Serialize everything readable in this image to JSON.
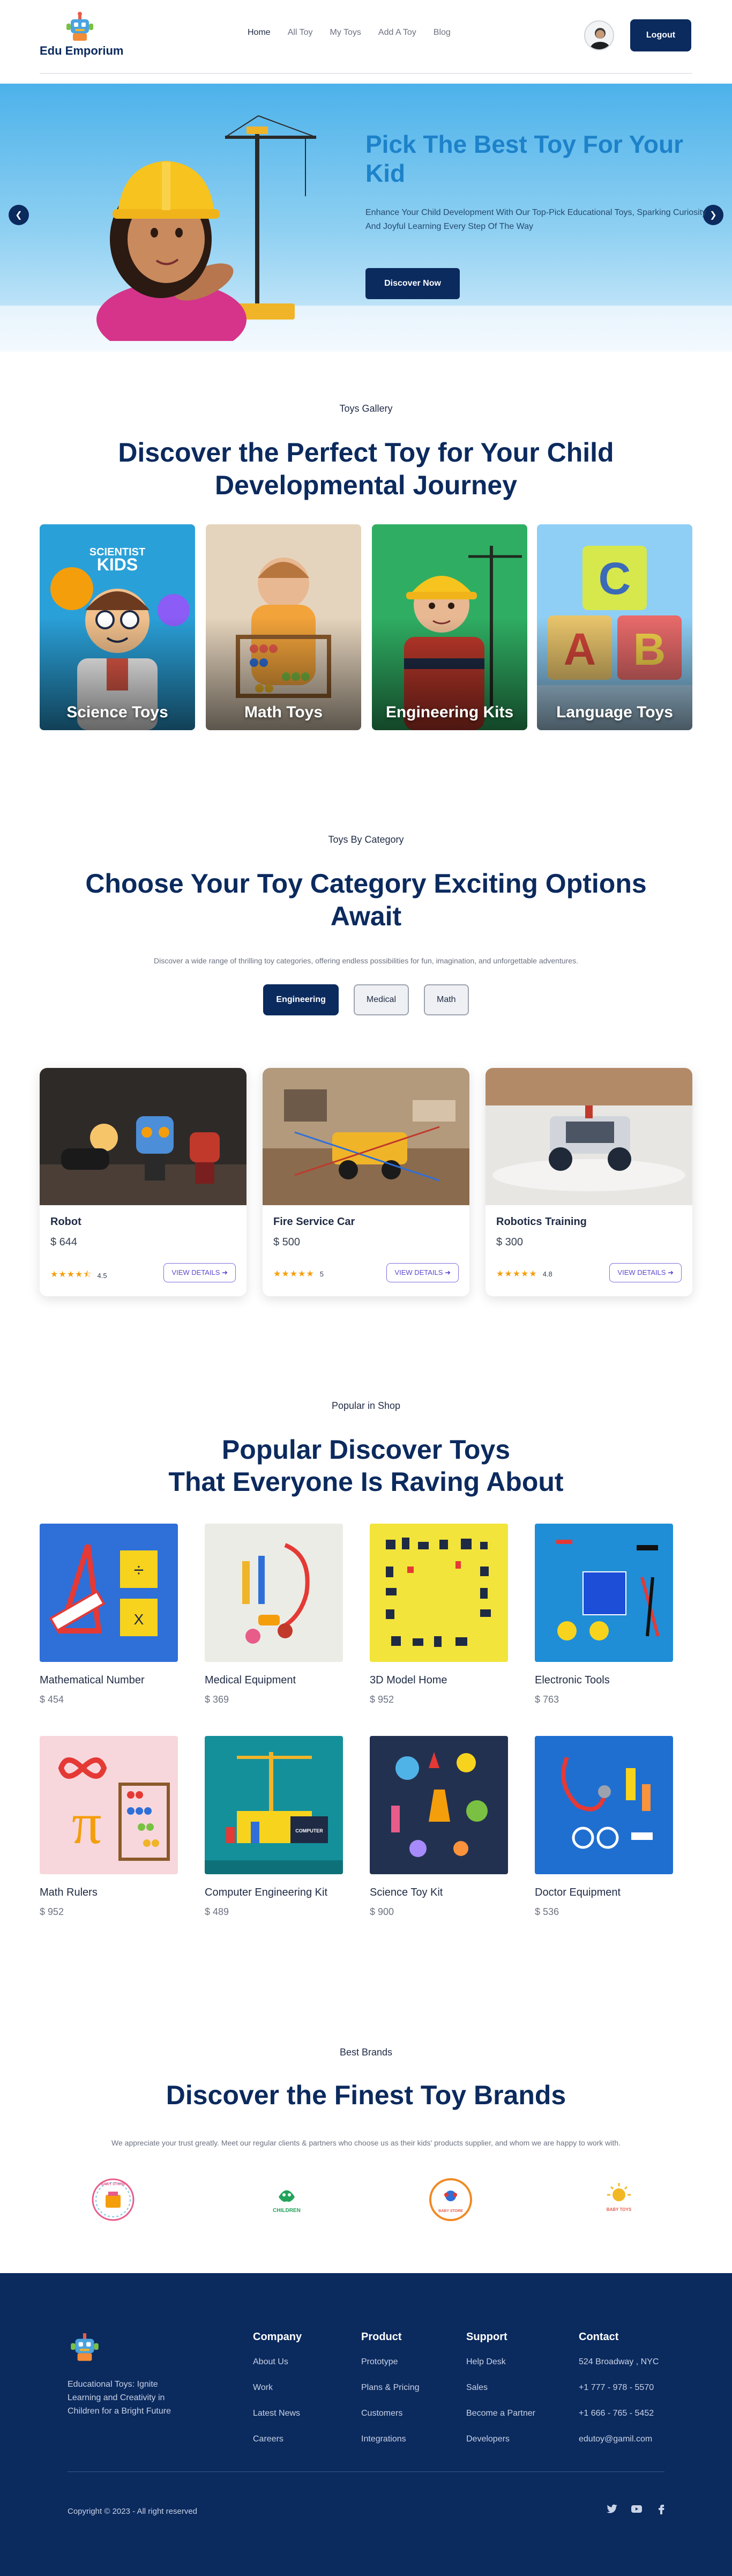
{
  "brand": {
    "name": "Edu Emporium"
  },
  "nav": {
    "links": [
      {
        "label": "Home",
        "active": true
      },
      {
        "label": "All Toy",
        "active": false
      },
      {
        "label": "My Toys",
        "active": false
      },
      {
        "label": "Add A Toy",
        "active": false
      },
      {
        "label": "Blog",
        "active": false
      }
    ],
    "logout": "Logout"
  },
  "hero": {
    "title": "Pick The Best Toy For Your Kid",
    "description": "Enhance Your Child Development With Our Top-Pick Educational Toys, Sparking Curiosity And Joyful Learning Every Step Of The Way",
    "cta": "Discover Now",
    "prev_icon": "arrow-left-icon",
    "next_icon": "arrow-right-icon"
  },
  "gallery": {
    "tag": "Toys Gallery",
    "title": "Discover the Perfect Toy for Your Child Developmental Journey",
    "cards": [
      {
        "label": "Science Toys",
        "badge": "SCIENTIST KIDS"
      },
      {
        "label": "Math Toys"
      },
      {
        "label": "Engineering Kits"
      },
      {
        "label": "Language Toys"
      }
    ]
  },
  "category": {
    "tag": "Toys By Category",
    "title": "Choose Your Toy Category Exciting Options Await",
    "subtitle": "Discover a wide range of thrilling toy categories, offering endless possibilities for fun, imagination, and unforgettable adventures.",
    "tabs": [
      {
        "label": "Engineering",
        "active": true
      },
      {
        "label": "Medical",
        "active": false
      },
      {
        "label": "Math",
        "active": false
      }
    ],
    "cards": [
      {
        "name": "Robot",
        "price": "$ 644",
        "rating": "4.5",
        "stars": "★★★★⯪",
        "button": "VIEW DETAILS"
      },
      {
        "name": "Fire Service Car",
        "price": "$ 500",
        "rating": "5",
        "stars": "★★★★★",
        "button": "VIEW DETAILS"
      },
      {
        "name": "Robotics Training",
        "price": "$ 300",
        "rating": "4.8",
        "stars": "★★★★★",
        "button": "VIEW DETAILS"
      }
    ]
  },
  "popular": {
    "tag": "Popular in Shop",
    "title_line1": "Popular Discover Toys",
    "title_line2": "That Everyone Is Raving About",
    "items": [
      {
        "name": "Mathematical Number",
        "price": "$ 454"
      },
      {
        "name": "Medical Equipment",
        "price": "$ 369"
      },
      {
        "name": "3D Model Home",
        "price": "$ 952"
      },
      {
        "name": "Electronic Tools",
        "price": "$ 763"
      },
      {
        "name": "Math Rulers",
        "price": "$ 952"
      },
      {
        "name": "Computer Engineering Kit",
        "price": "$ 489"
      },
      {
        "name": "Science Toy Kit",
        "price": "$ 900"
      },
      {
        "name": "Doctor Equipment",
        "price": "$ 536"
      }
    ]
  },
  "brands": {
    "tag": "Best Brands",
    "title": "Discover the Finest Toy Brands",
    "subtitle": "We appreciate your trust greatly. Meet our regular clients & partners who choose us as their kids' products supplier, and whom we are happy to work with.",
    "logos": [
      {
        "name": "BABY STORE",
        "color": "#e85c8a"
      },
      {
        "name": "CHILDREN",
        "color": "#21a45a"
      },
      {
        "name": "BABY STORE",
        "color": "#f08a24"
      },
      {
        "name": "BABY TOYS",
        "color": "#f2b824"
      }
    ]
  },
  "footer": {
    "description": "Educational Toys: Ignite Learning and Creativity in Children for a Bright Future",
    "columns": [
      {
        "title": "Company",
        "links": [
          "About Us",
          "Work",
          "Latest News",
          "Careers"
        ]
      },
      {
        "title": "Product",
        "links": [
          "Prototype",
          "Plans & Pricing",
          "Customers",
          "Integrations"
        ]
      },
      {
        "title": "Support",
        "links": [
          "Help Desk",
          "Sales",
          "Become a Partner",
          "Developers"
        ]
      },
      {
        "title": "Contact",
        "links": [
          "524 Broadway , NYC",
          "+1 777 - 978 - 5570",
          "+1 666 - 765 - 5452",
          "edutoy@gamil.com"
        ]
      }
    ],
    "copyright": "Copyright © 2023 - All right reserved",
    "social": [
      "twitter-icon",
      "youtube-icon",
      "facebook-icon"
    ]
  },
  "colors": {
    "primary": "#0b2a5e",
    "accent": "#1d82c9",
    "star": "#f59e0b",
    "button_outline": "#7c6ee0"
  }
}
